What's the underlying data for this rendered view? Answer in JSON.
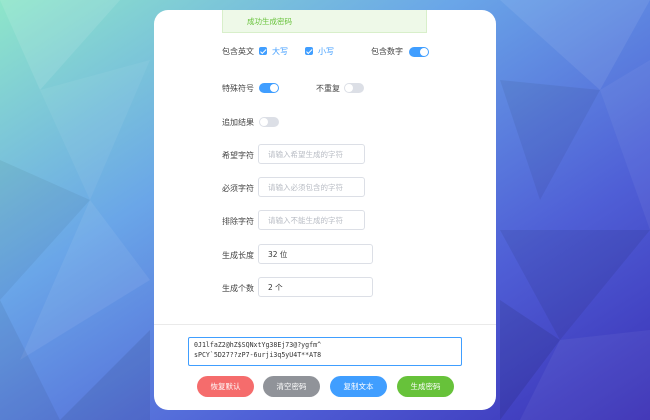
{
  "alert": {
    "text": "成功生成密码"
  },
  "options": {
    "english": {
      "label": "包含英文",
      "upper_label": "大写",
      "upper_checked": true,
      "lower_label": "小写",
      "lower_checked": true
    },
    "digits": {
      "label": "包含数字",
      "on": true
    },
    "special": {
      "label": "特殊符号",
      "on": true
    },
    "no_repeat": {
      "label": "不重复",
      "on": false
    },
    "append": {
      "label": "追加结果",
      "on": false
    }
  },
  "fields": {
    "desired": {
      "label": "希望字符",
      "placeholder": "请输入希望生成的字符",
      "value": ""
    },
    "required": {
      "label": "必须字符",
      "placeholder": "请输入必须包含的字符",
      "value": ""
    },
    "exclude": {
      "label": "排除字符",
      "placeholder": "请输入不能生成的字符",
      "value": ""
    },
    "length": {
      "label": "生成长度",
      "value": "32 位"
    },
    "count": {
      "label": "生成个数",
      "value": "2 个"
    }
  },
  "result": {
    "text": "0J1lfaZ2@hZ$SQNxtYg38Ej73@?ygfm^\nsPCY`5D27??zP7-6urji3q5yU4T**AT8"
  },
  "buttons": {
    "reset": {
      "label": "恢复默认",
      "color": "#f56c6c"
    },
    "clear": {
      "label": "清空密码",
      "color": "#909399"
    },
    "copy": {
      "label": "复制文本",
      "color": "#409eff"
    },
    "generate": {
      "label": "生成密码",
      "color": "#67c23a"
    }
  }
}
